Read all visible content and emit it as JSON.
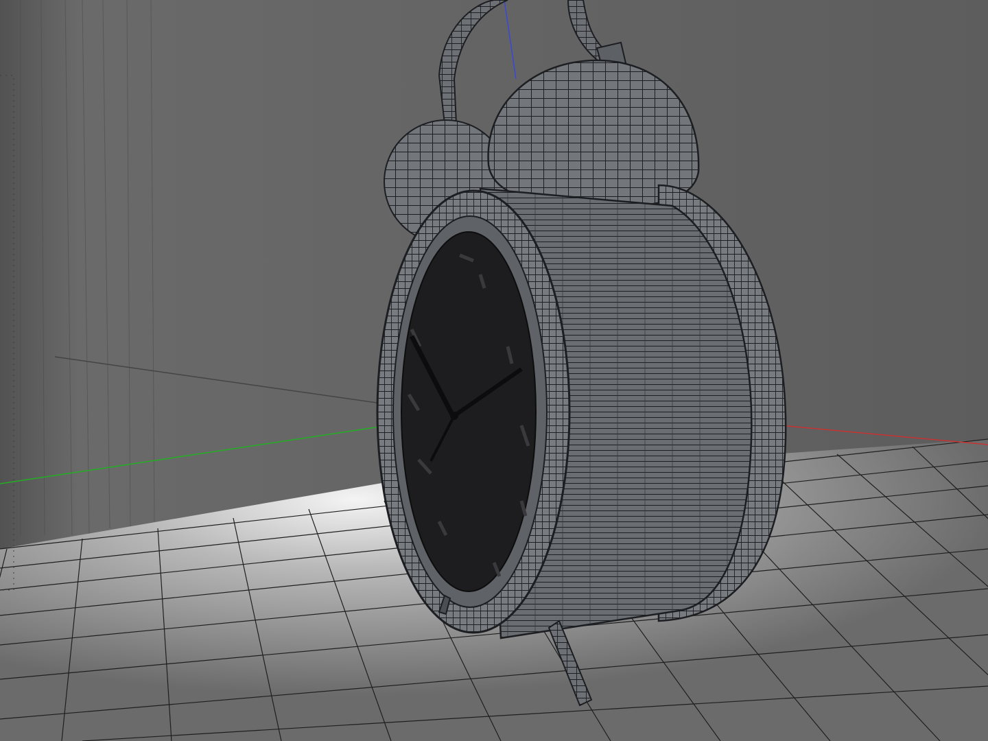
{
  "viewport": {
    "kind": "3d-wireframe-viewport",
    "object": "alarm-clock",
    "shading": "wireframe-on-shaded",
    "floor_grid": true,
    "axes_visible": [
      "x",
      "y",
      "z"
    ]
  },
  "colors": {
    "background_wall": "#5e5e5e",
    "floor": "#707070",
    "floor_highlight": "#f2f2f2",
    "grid_line": "#1e1e1e",
    "mesh_fill": "#6d7176",
    "mesh_wire": "#1c1e21",
    "dial": "#1d1d1f",
    "axis_x": "#c83232",
    "axis_y": "#22b022",
    "axis_z": "#3848d8"
  },
  "icons": [
    "clock-mesh",
    "axis-gizmo"
  ]
}
